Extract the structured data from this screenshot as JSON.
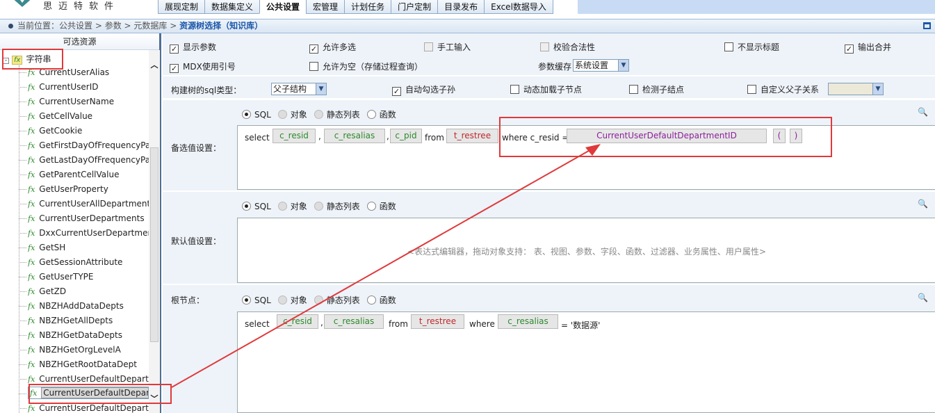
{
  "app": {
    "logo_text": "思迈特软件"
  },
  "tabs": [
    "展现定制",
    "数据集定义",
    "公共设置",
    "宏管理",
    "计划任务",
    "门户定制",
    "目录发布",
    "Excel数据导入"
  ],
  "active_tab": "公共设置",
  "breadcrumb": {
    "prefix": "当前位置：",
    "path": "公共设置 > 参数 > 元数据库 > ",
    "current": "资源树选择（知识库）"
  },
  "left": {
    "title": "可选资源",
    "root": "字符串",
    "items": [
      "CurrentUserAlias",
      "CurrentUserID",
      "CurrentUserName",
      "GetCellValue",
      "GetCookie",
      "GetFirstDayOfFrequencyPar",
      "GetLastDayOfFrequencyPar",
      "GetParentCellValue",
      "GetUserProperty",
      "CurrentUserAllDepartmentID",
      "CurrentUserDepartments",
      "DxxCurrentUserDepartments",
      "GetSH",
      "GetSessionAttribute",
      "GetUserTYPE",
      "GetZD",
      "NBZHAddDataDepts",
      "NBZHGetAllDepts",
      "NBZHGetDataDepts",
      "NBZHGetOrgLevelA",
      "NBZHGetRootDataDept",
      "CurrentUserDefaultDepartme",
      "CurrentUserDefaultDepartme",
      "CurrentUserDefaultDepartme"
    ],
    "selected_index": 22
  },
  "options": {
    "show_param": "显示参数",
    "allow_multi": "允许多选",
    "manual_input": "手工输入",
    "validate": "校验合法性",
    "hide_title": "不显示标题",
    "output_merge": "输出合并",
    "mdx_quote": "MDX使用引号",
    "allow_empty": "允许为空（存储过程查询）",
    "cache_label": "参数缓存",
    "cache_value": "系统设置",
    "tree_sql_label": "构建树的sql类型：",
    "tree_sql_value": "父子结构",
    "auto_check": "自动勾选子孙",
    "dyn_load": "动态加载子节点",
    "check_child": "检测子结点",
    "custom_rel": "自定义父子关系"
  },
  "radio_labels": [
    "SQL",
    "对象",
    "静态列表",
    "函数"
  ],
  "candidate": {
    "title": "备选值设置：",
    "select": "select",
    "from": "from",
    "where": "where c_resid =",
    "fields": [
      "c_resid",
      "c_resalias",
      "c_pid"
    ],
    "table": "t_restree",
    "func": "CurrentUserDefaultDepartmentID",
    "lparen": "(",
    "rparen": ")"
  },
  "default": {
    "title": "默认值设置：",
    "hint": "<表达式编辑器，拖动对象支持：  表、视图、参数、字段、函数、过滤器、业务属性、用户属性>"
  },
  "rootnode": {
    "title": "根节点：",
    "select": "select",
    "from": "from",
    "where": "where",
    "fields": [
      "c_resid",
      "c_resalias"
    ],
    "table": "t_restree",
    "where_field": "c_resalias",
    "tail": "= '数据源'"
  },
  "colors": {
    "accent": "#1b56a8",
    "red": "#e0393b",
    "green": "#2c8a2c",
    "purple": "#8a1f9a"
  }
}
